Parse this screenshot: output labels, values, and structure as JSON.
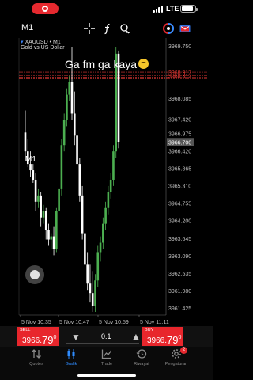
{
  "status_bar": {
    "network": "LTE",
    "recording": true,
    "battery_level_pct": 85
  },
  "toolbar": {
    "timeframe": "M1",
    "icons": [
      "crosshair-icon",
      "indicator-f-icon",
      "objects-icon",
      "trade-account-icon",
      "mail-icon"
    ]
  },
  "chart": {
    "symbol": "XAUUSD",
    "timeframe": "M1",
    "description": "Gold vs US Dollar",
    "overlay_text": "Ga fm ga kaya",
    "current_price_label": "3966.700",
    "price_labels": [
      "3969.750",
      "3968.917",
      "3968.812",
      "3968.085",
      "3967.420",
      "3966.975",
      "3966.700",
      "3966.420",
      "3965.865",
      "3965.310",
      "3964.755",
      "3964.200",
      "3963.645",
      "3963.090",
      "3962.535",
      "3961.980",
      "3961.425"
    ],
    "time_labels": [
      "5 Nov 10:35",
      "5 Nov 10:47",
      "5 Nov 10:59",
      "5 Nov 11:11"
    ],
    "colors": {
      "bull": "#4caf50",
      "bear": "#ffffff",
      "level_line": "#e53935",
      "background": "#000000"
    }
  },
  "chart_data": {
    "type": "candlestick",
    "symbol": "XAUUSD",
    "timeframe": "M1",
    "title": "XAUUSD • M1",
    "subtitle": "Gold vs US Dollar",
    "ylim": [
      3961.2,
      3970.0
    ],
    "y_ticks": [
      3969.75,
      3969.195,
      3968.64,
      3968.085,
      3967.53,
      3966.975,
      3966.42,
      3965.865,
      3965.31,
      3964.755,
      3964.2,
      3963.645,
      3963.09,
      3962.535,
      3961.98,
      3961.425
    ],
    "x_ticks": [
      "5 Nov 10:35",
      "5 Nov 10:47",
      "5 Nov 10:59",
      "5 Nov 11:11"
    ],
    "horizontal_levels": [
      3968.917,
      3968.812,
      3968.75,
      3968.7,
      3968.6,
      3966.7
    ],
    "current_price": 3966.7,
    "grid": false,
    "candles": [
      {
        "o": 3967.0,
        "h": 3967.7,
        "l": 3966.1,
        "c": 3966.4
      },
      {
        "o": 3966.4,
        "h": 3966.8,
        "l": 3965.9,
        "c": 3966.0
      },
      {
        "o": 3966.0,
        "h": 3966.4,
        "l": 3965.6,
        "c": 3965.8
      },
      {
        "o": 3965.8,
        "h": 3966.0,
        "l": 3965.4,
        "c": 3965.5
      },
      {
        "o": 3965.5,
        "h": 3965.7,
        "l": 3964.5,
        "c": 3964.8
      },
      {
        "o": 3964.8,
        "h": 3965.2,
        "l": 3964.6,
        "c": 3965.0
      },
      {
        "o": 3965.0,
        "h": 3965.1,
        "l": 3964.0,
        "c": 3964.3
      },
      {
        "o": 3964.3,
        "h": 3964.7,
        "l": 3964.1,
        "c": 3964.5
      },
      {
        "o": 3964.5,
        "h": 3964.6,
        "l": 3963.6,
        "c": 3963.9
      },
      {
        "o": 3963.9,
        "h": 3964.1,
        "l": 3963.4,
        "c": 3963.6
      },
      {
        "o": 3963.6,
        "h": 3963.8,
        "l": 3963.3,
        "c": 3963.7
      },
      {
        "o": 3963.7,
        "h": 3964.0,
        "l": 3963.1,
        "c": 3963.3
      },
      {
        "o": 3963.3,
        "h": 3964.6,
        "l": 3963.2,
        "c": 3964.5
      },
      {
        "o": 3964.5,
        "h": 3965.3,
        "l": 3964.3,
        "c": 3965.2
      },
      {
        "o": 3965.2,
        "h": 3966.8,
        "l": 3965.0,
        "c": 3966.6
      },
      {
        "o": 3966.6,
        "h": 3967.6,
        "l": 3966.4,
        "c": 3967.4
      },
      {
        "o": 3967.4,
        "h": 3968.4,
        "l": 3967.2,
        "c": 3968.2
      },
      {
        "o": 3968.2,
        "h": 3968.8,
        "l": 3968.0,
        "c": 3968.6
      },
      {
        "o": 3968.6,
        "h": 3969.7,
        "l": 3967.4,
        "c": 3967.6
      },
      {
        "o": 3967.6,
        "h": 3968.3,
        "l": 3966.6,
        "c": 3966.9
      },
      {
        "o": 3966.9,
        "h": 3967.1,
        "l": 3965.8,
        "c": 3966.0
      },
      {
        "o": 3966.0,
        "h": 3966.2,
        "l": 3964.8,
        "c": 3965.0
      },
      {
        "o": 3965.0,
        "h": 3965.3,
        "l": 3963.6,
        "c": 3963.8
      },
      {
        "o": 3963.8,
        "h": 3964.1,
        "l": 3962.6,
        "c": 3962.8
      },
      {
        "o": 3962.8,
        "h": 3963.2,
        "l": 3962.0,
        "c": 3962.2
      },
      {
        "o": 3962.2,
        "h": 3962.8,
        "l": 3961.6,
        "c": 3961.9
      },
      {
        "o": 3961.9,
        "h": 3962.6,
        "l": 3961.3,
        "c": 3961.5
      },
      {
        "o": 3961.5,
        "h": 3962.5,
        "l": 3961.3,
        "c": 3962.3
      },
      {
        "o": 3962.3,
        "h": 3963.4,
        "l": 3962.1,
        "c": 3963.2
      },
      {
        "o": 3963.2,
        "h": 3963.7,
        "l": 3962.9,
        "c": 3963.5
      },
      {
        "o": 3963.5,
        "h": 3964.3,
        "l": 3963.3,
        "c": 3964.1
      },
      {
        "o": 3964.1,
        "h": 3964.8,
        "l": 3963.9,
        "c": 3964.6
      },
      {
        "o": 3964.6,
        "h": 3965.3,
        "l": 3964.4,
        "c": 3965.1
      },
      {
        "o": 3965.1,
        "h": 3965.7,
        "l": 3964.9,
        "c": 3965.5
      },
      {
        "o": 3965.5,
        "h": 3966.6,
        "l": 3965.3,
        "c": 3966.4
      },
      {
        "o": 3966.4,
        "h": 3969.7,
        "l": 3966.2,
        "c": 3969.5
      },
      {
        "o": 3969.5,
        "h": 3969.6,
        "l": 3966.5,
        "c": 3966.7
      }
    ]
  },
  "trade_bar": {
    "sell": {
      "label": "SELL",
      "price_main": "3966.",
      "price_big": "79",
      "price_sup": "0"
    },
    "buy": {
      "label": "BUY",
      "price_main": "3966.",
      "price_big": "79",
      "price_sup": "0"
    },
    "lot_minus": "▼",
    "lot_value": "0.1",
    "lot_plus": "▲"
  },
  "nav": {
    "items": [
      {
        "label": "Quotes",
        "icon": "quotes-arrows-icon"
      },
      {
        "label": "Grafik",
        "icon": "chart-candles-icon"
      },
      {
        "label": "Trade",
        "icon": "trade-chart-icon"
      },
      {
        "label": "Riwayat",
        "icon": "history-clock-icon"
      },
      {
        "label": "Pengaturan",
        "icon": "settings-gear-icon"
      }
    ],
    "settings_badge": "2"
  }
}
